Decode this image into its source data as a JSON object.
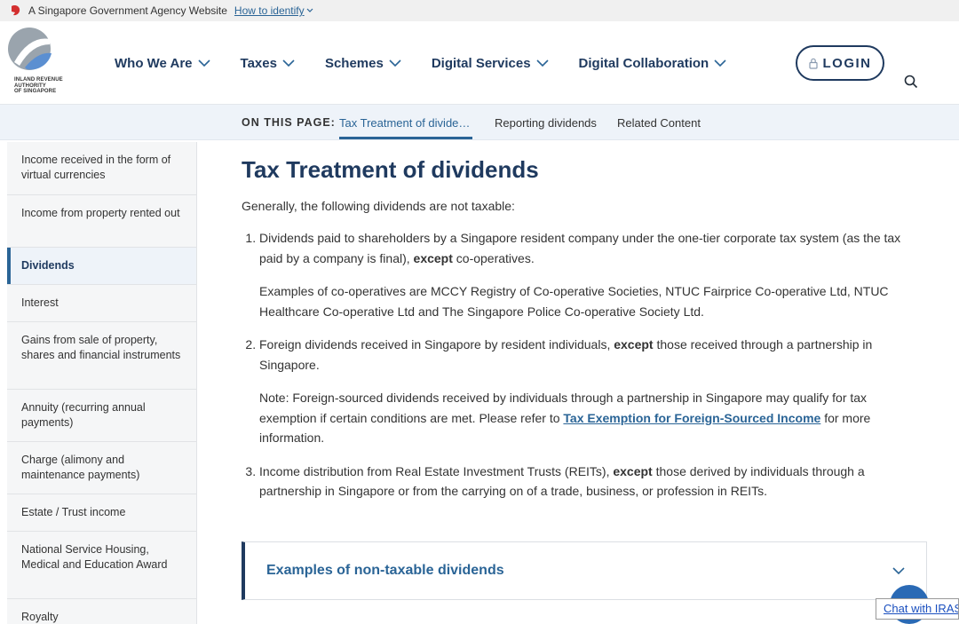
{
  "gov_banner": {
    "text": "A Singapore Government Agency Website",
    "link": "How to identify"
  },
  "logo": {
    "text": "INLAND REVENUE\nAUTHORITY\nOF SINGAPORE"
  },
  "nav": {
    "items": [
      {
        "label": "Who We Are"
      },
      {
        "label": "Taxes"
      },
      {
        "label": "Schemes"
      },
      {
        "label": "Digital Services"
      },
      {
        "label": "Digital Collaboration"
      }
    ],
    "login_label": "LOGIN"
  },
  "on_this_page": {
    "label": "ON THIS PAGE:",
    "links": [
      "Tax Treatment of divide…",
      "Reporting dividends",
      "Related Content"
    ]
  },
  "sidebar": {
    "items": [
      {
        "label": "Income received in the form of virtual currencies"
      },
      {
        "label": "Income from property rented out"
      },
      {
        "label": "Dividends"
      },
      {
        "label": "Interest"
      },
      {
        "label": "Gains from sale of property, shares and financial instruments"
      },
      {
        "label": "Annuity (recurring annual payments)"
      },
      {
        "label": "Charge (alimony and maintenance payments)"
      },
      {
        "label": "Estate / Trust income"
      },
      {
        "label": "National Service Housing, Medical and Education Award"
      },
      {
        "label": "Royalty"
      }
    ]
  },
  "content": {
    "title": "Tax Treatment of dividends",
    "intro": "Generally, the following dividends are not taxable:",
    "item1_text": "Dividends paid to shareholders by a Singapore resident company under the one-tier corporate tax system (as the tax paid by a company is final), ",
    "item1_bold": "except",
    "item1_end": " co-operatives.",
    "item1_note": "Examples of co-operatives are MCCY Registry of Co-operative Societies, NTUC Fairprice Co-operative Ltd, NTUC Healthcare Co-operative Ltd and The Singapore Police Co-operative Society Ltd.",
    "item2_text": "Foreign dividends received in Singapore by resident individuals, ",
    "item2_bold": "except",
    "item2_end": " those received through a partnership in Singapore.",
    "item2_note_start": "Note: Foreign-sourced dividends received by individuals through a partnership in Singapore may qualify for tax exemption if certain conditions are met. Please refer to ",
    "item2_note_link": "Tax Exemption for Foreign-Sourced Income",
    "item2_note_end": " for more information.",
    "item3_text": "Income distribution from Real Estate Investment Trusts (REITs), ",
    "item3_bold": "except",
    "item3_end": " those derived by individuals through a partnership in Singapore or from the carrying on of a trade, business, or profession in REITs."
  },
  "accordion": {
    "label": "Examples of non-taxable dividends"
  },
  "chat": {
    "label": "Chat with IRAS"
  },
  "colors": {
    "primary": "#1f3a5f",
    "link": "#2a6496",
    "accent_bar": "#eef3f9"
  }
}
